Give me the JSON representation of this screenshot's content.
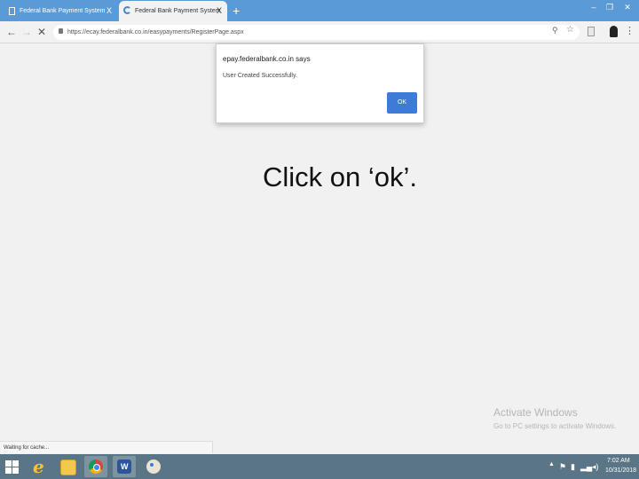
{
  "browser": {
    "tabs": [
      {
        "title": "Federal Bank Payment System",
        "close": "X",
        "active": false
      },
      {
        "title": "Federal Bank Payment System",
        "close": "X",
        "active": true
      }
    ],
    "new_tab": "+",
    "window_controls": {
      "minimize": "–",
      "maximize": "❐",
      "close": "✕"
    },
    "url": "https://ecay.federalbank.co.in/easypayments/RegisterPage.aspx",
    "nav_icons": {
      "back": "←",
      "forward": "→",
      "stop": "✕"
    }
  },
  "dialog": {
    "title": "epay.federalbank.co.in says",
    "message": "User Created Successfully.",
    "ok_label": "OK"
  },
  "caption": "Click on ‘ok’.",
  "watermark": {
    "title": "Activate Windows",
    "subtitle": "Go to PC settings to activate Windows."
  },
  "status_text": "Waiting for cache...",
  "taskbar": {
    "apps": [
      "internet-explorer",
      "file-explorer",
      "chrome",
      "word",
      "paint"
    ],
    "time": "7:02 AM",
    "date": "10/31/2018"
  },
  "colors": {
    "tab_strip": "#5b9bd5",
    "ok_button": "#3d7bd6",
    "taskbar": "#5a7586"
  }
}
